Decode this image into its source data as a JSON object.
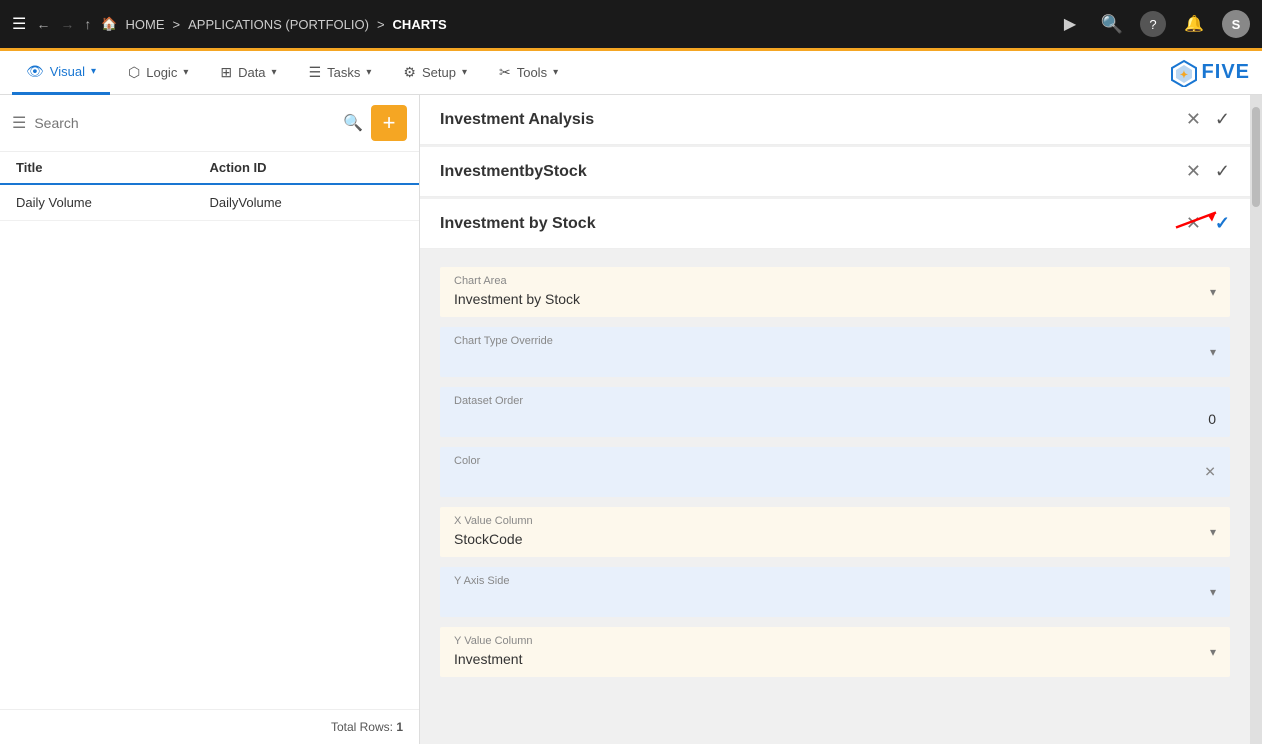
{
  "topNav": {
    "hamburger": "☰",
    "backArrow": "←",
    "upArrow": "↑",
    "forwardArrow": "→",
    "homeLabel": "HOME",
    "sep1": ">",
    "appLabel": "APPLICATIONS (PORTFOLIO)",
    "sep2": ">",
    "chartsLabel": "CHARTS",
    "playIcon": "▶",
    "searchIcon": "◎",
    "helpIcon": "?",
    "bellIcon": "🔔",
    "avatarLetter": "S"
  },
  "secondNav": {
    "tabs": [
      {
        "id": "visual",
        "label": "Visual",
        "active": true,
        "icon": "👁"
      },
      {
        "id": "logic",
        "label": "Logic",
        "active": false,
        "icon": "⬡"
      },
      {
        "id": "data",
        "label": "Data",
        "active": false,
        "icon": "⊞"
      },
      {
        "id": "tasks",
        "label": "Tasks",
        "active": false,
        "icon": "☰"
      },
      {
        "id": "setup",
        "label": "Setup",
        "active": false,
        "icon": "⚙"
      },
      {
        "id": "tools",
        "label": "Tools",
        "active": false,
        "icon": "✂"
      }
    ],
    "logoStars": "✦",
    "logoText": "FIVE"
  },
  "sidebar": {
    "searchPlaceholder": "Search",
    "addBtnLabel": "+",
    "columns": {
      "title": "Title",
      "actionId": "Action ID"
    },
    "rows": [
      {
        "title": "Daily Volume",
        "actionId": "DailyVolume"
      }
    ],
    "footer": "Total Rows: 1"
  },
  "rightPanel": {
    "investmentAnalysis": {
      "title": "Investment Analysis"
    },
    "investmentByStockHeader": {
      "title": "InvestmentbyStock"
    },
    "investmentByStock": {
      "title": "Investment by Stock"
    },
    "form": {
      "chartArea": {
        "label": "Chart Area",
        "value": "Investment by Stock"
      },
      "chartTypeOverride": {
        "label": "Chart Type Override",
        "value": ""
      },
      "datasetOrder": {
        "label": "Dataset Order",
        "value": "0"
      },
      "color": {
        "label": "Color",
        "value": ""
      },
      "xValueColumn": {
        "label": "X Value Column",
        "value": "StockCode"
      },
      "yAxisSide": {
        "label": "Y Axis Side",
        "value": ""
      },
      "yValueColumn": {
        "label": "Y Value Column",
        "value": "Investment"
      }
    }
  }
}
